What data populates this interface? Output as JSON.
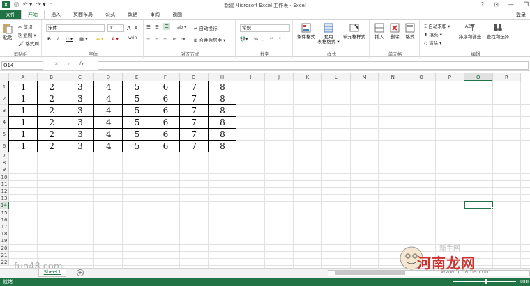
{
  "window": {
    "title": "新建 Microsoft Excel 工作表 - Excel",
    "controls": [
      "?",
      "⊡",
      "—",
      "❐"
    ]
  },
  "tabs": {
    "file": "文件",
    "items": [
      "开始",
      "插入",
      "页面布局",
      "公式",
      "数据",
      "审阅",
      "视图"
    ],
    "active": "开始",
    "login": "登录"
  },
  "ribbon": {
    "clipboard": {
      "label": "剪贴板",
      "paste": "粘贴",
      "cut": "剪切",
      "copy": "复制 ▾",
      "format_painter": "格式刷"
    },
    "font": {
      "label": "字体",
      "name": "宋体",
      "size": "11",
      "grow": "A",
      "shrink": "A",
      "bold": "B",
      "italic": "I",
      "underline": "U ▾",
      "wen": "wén"
    },
    "alignment": {
      "label": "对齐方式",
      "wrap": "自动换行",
      "merge": "合并后居中 ▾"
    },
    "number": {
      "label": "数字",
      "format": "常规",
      "percent": "%",
      "comma": ","
    },
    "styles": {
      "label": "样式",
      "conditional": "条件格式",
      "table": "套用\n表格格式 ▾",
      "cell_styles": "单元格样式"
    },
    "cells": {
      "label": "单元格",
      "insert": "插入",
      "delete": "删除",
      "format": "格式"
    },
    "editing": {
      "label": "编辑",
      "autosum": "自动求和 ▾",
      "fill": "填充 ▾",
      "clear": "清除 ▾",
      "sort": "排序和筛选",
      "find": "查找和选择"
    }
  },
  "formula_bar": {
    "name_box": "Q14",
    "cancel": "✕",
    "enter": "✓",
    "fx": "fx",
    "value": ""
  },
  "grid": {
    "columns": [
      "A",
      "B",
      "C",
      "D",
      "E",
      "F",
      "G",
      "H",
      "I",
      "J",
      "K",
      "L",
      "M",
      "N",
      "O",
      "P",
      "Q",
      "R"
    ],
    "active_column": "Q",
    "rows": [
      "1",
      "2",
      "3",
      "4",
      "5",
      "6",
      "7",
      "8",
      "9",
      "10",
      "11",
      "12",
      "13",
      "14",
      "15",
      "16",
      "17",
      "18",
      "19",
      "20",
      "21",
      "22"
    ],
    "active_row": "14",
    "data": [
      [
        "1",
        "2",
        "3",
        "4",
        "5",
        "6",
        "7",
        "8"
      ],
      [
        "1",
        "2",
        "3",
        "4",
        "5",
        "6",
        "7",
        "8"
      ],
      [
        "1",
        "2",
        "3",
        "4",
        "5",
        "6",
        "7",
        "8"
      ],
      [
        "1",
        "2",
        "3",
        "4",
        "5",
        "6",
        "7",
        "8"
      ],
      [
        "1",
        "2",
        "3",
        "4",
        "5",
        "6",
        "7",
        "8"
      ],
      [
        "1",
        "2",
        "3",
        "4",
        "5",
        "6",
        "7",
        "8"
      ]
    ]
  },
  "sheets": {
    "tabs": [
      "Sheet1"
    ],
    "add": "+"
  },
  "status": {
    "text": "就绪",
    "zoom": "100"
  },
  "watermarks": {
    "left": "fun48.com",
    "right_main": "河南龙网",
    "right_sub": "www.5mama.com",
    "right_top": "新手网"
  }
}
